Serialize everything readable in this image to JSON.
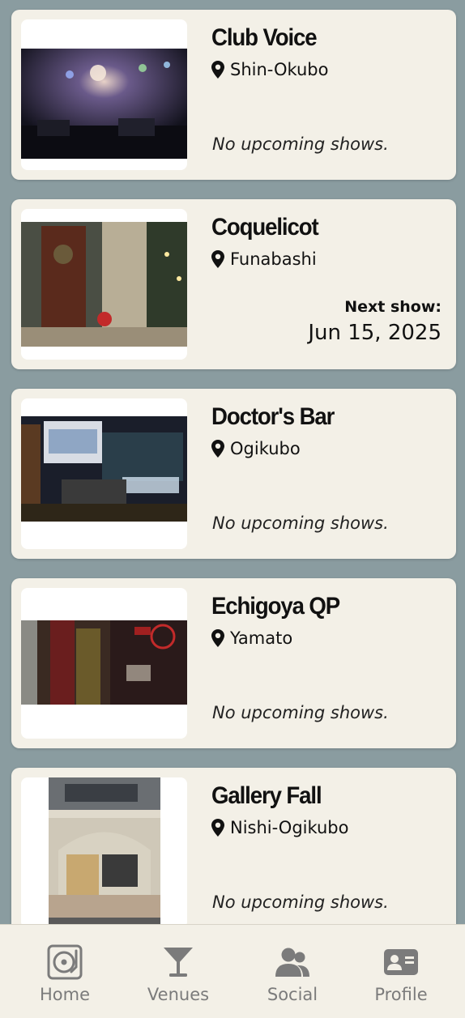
{
  "venues": [
    {
      "name": "Club Voice",
      "location": "Shin-Okubo",
      "status": "No upcoming shows."
    },
    {
      "name": "Coquelicot",
      "location": "Funabashi",
      "next_label": "Next show:",
      "next_date": "Jun 15, 2025"
    },
    {
      "name": "Doctor's Bar",
      "location": "Ogikubo",
      "status": "No upcoming shows."
    },
    {
      "name": "Echigoya QP",
      "location": "Yamato",
      "status": "No upcoming shows."
    },
    {
      "name": "Gallery Fall",
      "location": "Nishi-Ogikubo",
      "status": "No upcoming shows."
    }
  ],
  "tabbar": {
    "items": [
      {
        "label": "Home",
        "icon": "turntable-icon"
      },
      {
        "label": "Venues",
        "icon": "cocktail-icon"
      },
      {
        "label": "Social",
        "icon": "users-icon"
      },
      {
        "label": "Profile",
        "icon": "id-card-icon"
      }
    ]
  },
  "colors": {
    "background": "#8a9ca0",
    "card": "#f3f0e7",
    "text": "#111111",
    "tab_inactive": "#7b7b7b"
  }
}
